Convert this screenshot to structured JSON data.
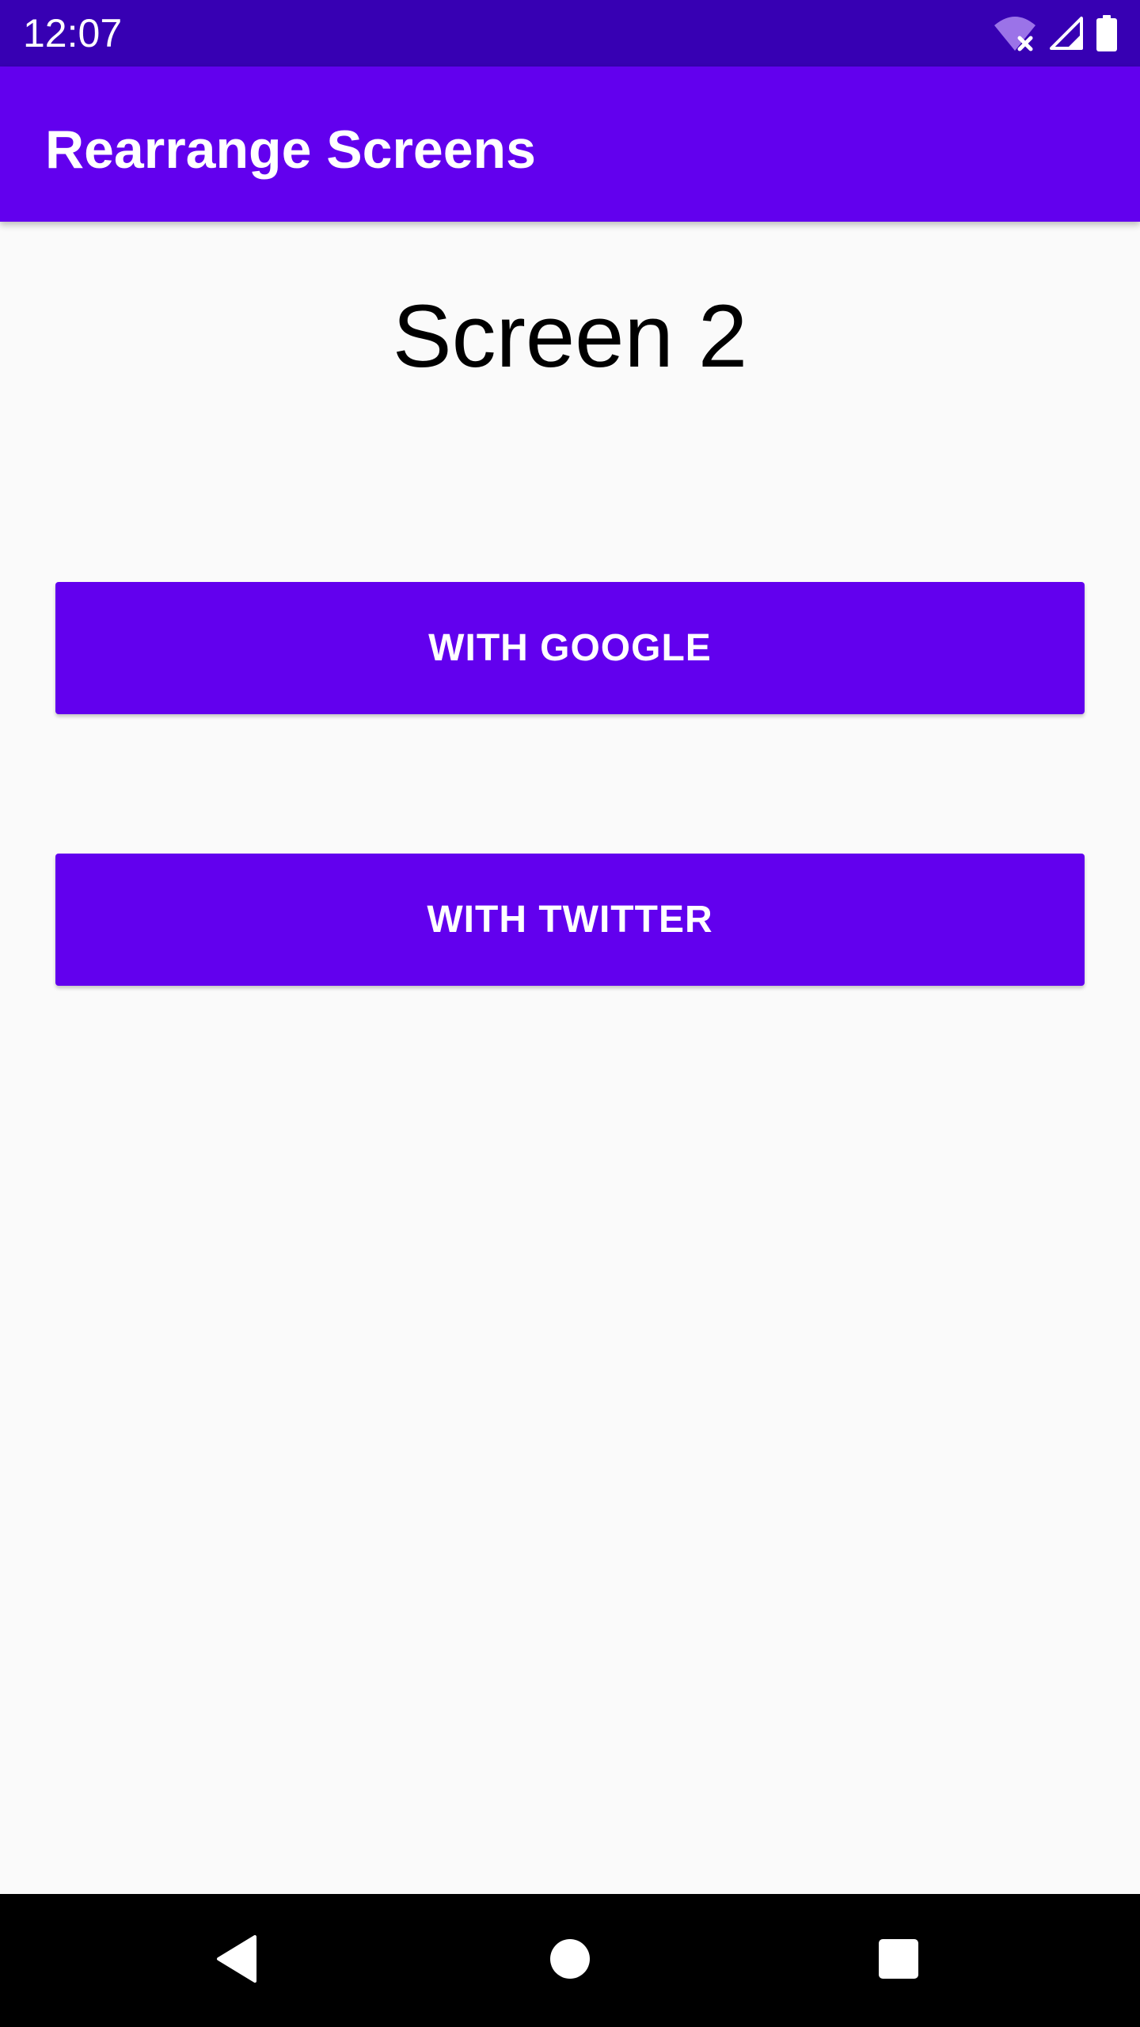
{
  "status_bar": {
    "time": "12:07",
    "icons": [
      "wifi-no-internet-icon",
      "cellular-signal-icon",
      "battery-full-icon"
    ],
    "background": "#3700b3"
  },
  "app_bar": {
    "title": "Rearrange Screens",
    "background": "#6200ee"
  },
  "main": {
    "heading": "Screen 2",
    "buttons": [
      {
        "label": "WITH GOOGLE"
      },
      {
        "label": "WITH TWITTER"
      }
    ],
    "button_color": "#6200ee",
    "background": "#fafafa"
  },
  "nav_bar": {
    "icons": [
      "back-icon",
      "home-icon",
      "recents-icon"
    ],
    "background": "#000000"
  }
}
